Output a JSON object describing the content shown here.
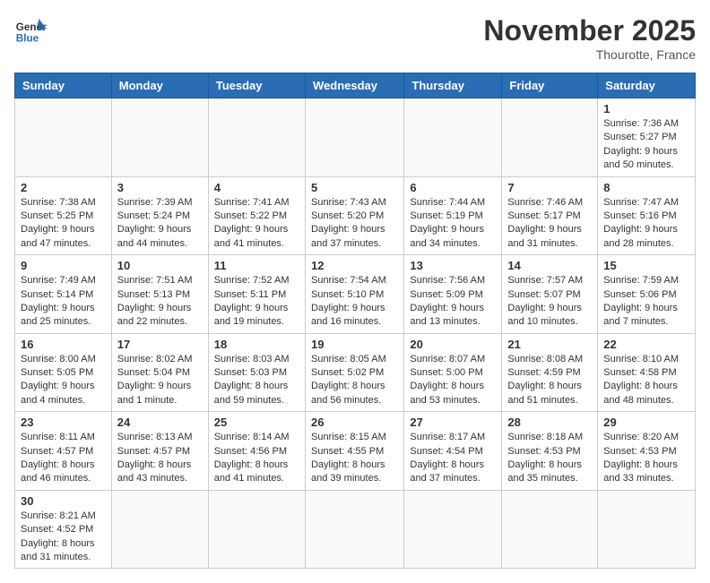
{
  "header": {
    "logo_text_general": "General",
    "logo_text_blue": "Blue",
    "month_title": "November 2025",
    "location": "Thourotte, France"
  },
  "weekdays": [
    "Sunday",
    "Monday",
    "Tuesday",
    "Wednesday",
    "Thursday",
    "Friday",
    "Saturday"
  ],
  "weeks": [
    [
      {
        "day": "",
        "info": ""
      },
      {
        "day": "",
        "info": ""
      },
      {
        "day": "",
        "info": ""
      },
      {
        "day": "",
        "info": ""
      },
      {
        "day": "",
        "info": ""
      },
      {
        "day": "",
        "info": ""
      },
      {
        "day": "1",
        "info": "Sunrise: 7:36 AM\nSunset: 5:27 PM\nDaylight: 9 hours\nand 50 minutes."
      }
    ],
    [
      {
        "day": "2",
        "info": "Sunrise: 7:38 AM\nSunset: 5:25 PM\nDaylight: 9 hours\nand 47 minutes."
      },
      {
        "day": "3",
        "info": "Sunrise: 7:39 AM\nSunset: 5:24 PM\nDaylight: 9 hours\nand 44 minutes."
      },
      {
        "day": "4",
        "info": "Sunrise: 7:41 AM\nSunset: 5:22 PM\nDaylight: 9 hours\nand 41 minutes."
      },
      {
        "day": "5",
        "info": "Sunrise: 7:43 AM\nSunset: 5:20 PM\nDaylight: 9 hours\nand 37 minutes."
      },
      {
        "day": "6",
        "info": "Sunrise: 7:44 AM\nSunset: 5:19 PM\nDaylight: 9 hours\nand 34 minutes."
      },
      {
        "day": "7",
        "info": "Sunrise: 7:46 AM\nSunset: 5:17 PM\nDaylight: 9 hours\nand 31 minutes."
      },
      {
        "day": "8",
        "info": "Sunrise: 7:47 AM\nSunset: 5:16 PM\nDaylight: 9 hours\nand 28 minutes."
      }
    ],
    [
      {
        "day": "9",
        "info": "Sunrise: 7:49 AM\nSunset: 5:14 PM\nDaylight: 9 hours\nand 25 minutes."
      },
      {
        "day": "10",
        "info": "Sunrise: 7:51 AM\nSunset: 5:13 PM\nDaylight: 9 hours\nand 22 minutes."
      },
      {
        "day": "11",
        "info": "Sunrise: 7:52 AM\nSunset: 5:11 PM\nDaylight: 9 hours\nand 19 minutes."
      },
      {
        "day": "12",
        "info": "Sunrise: 7:54 AM\nSunset: 5:10 PM\nDaylight: 9 hours\nand 16 minutes."
      },
      {
        "day": "13",
        "info": "Sunrise: 7:56 AM\nSunset: 5:09 PM\nDaylight: 9 hours\nand 13 minutes."
      },
      {
        "day": "14",
        "info": "Sunrise: 7:57 AM\nSunset: 5:07 PM\nDaylight: 9 hours\nand 10 minutes."
      },
      {
        "day": "15",
        "info": "Sunrise: 7:59 AM\nSunset: 5:06 PM\nDaylight: 9 hours\nand 7 minutes."
      }
    ],
    [
      {
        "day": "16",
        "info": "Sunrise: 8:00 AM\nSunset: 5:05 PM\nDaylight: 9 hours\nand 4 minutes."
      },
      {
        "day": "17",
        "info": "Sunrise: 8:02 AM\nSunset: 5:04 PM\nDaylight: 9 hours\nand 1 minute."
      },
      {
        "day": "18",
        "info": "Sunrise: 8:03 AM\nSunset: 5:03 PM\nDaylight: 8 hours\nand 59 minutes."
      },
      {
        "day": "19",
        "info": "Sunrise: 8:05 AM\nSunset: 5:02 PM\nDaylight: 8 hours\nand 56 minutes."
      },
      {
        "day": "20",
        "info": "Sunrise: 8:07 AM\nSunset: 5:00 PM\nDaylight: 8 hours\nand 53 minutes."
      },
      {
        "day": "21",
        "info": "Sunrise: 8:08 AM\nSunset: 4:59 PM\nDaylight: 8 hours\nand 51 minutes."
      },
      {
        "day": "22",
        "info": "Sunrise: 8:10 AM\nSunset: 4:58 PM\nDaylight: 8 hours\nand 48 minutes."
      }
    ],
    [
      {
        "day": "23",
        "info": "Sunrise: 8:11 AM\nSunset: 4:57 PM\nDaylight: 8 hours\nand 46 minutes."
      },
      {
        "day": "24",
        "info": "Sunrise: 8:13 AM\nSunset: 4:57 PM\nDaylight: 8 hours\nand 43 minutes."
      },
      {
        "day": "25",
        "info": "Sunrise: 8:14 AM\nSunset: 4:56 PM\nDaylight: 8 hours\nand 41 minutes."
      },
      {
        "day": "26",
        "info": "Sunrise: 8:15 AM\nSunset: 4:55 PM\nDaylight: 8 hours\nand 39 minutes."
      },
      {
        "day": "27",
        "info": "Sunrise: 8:17 AM\nSunset: 4:54 PM\nDaylight: 8 hours\nand 37 minutes."
      },
      {
        "day": "28",
        "info": "Sunrise: 8:18 AM\nSunset: 4:53 PM\nDaylight: 8 hours\nand 35 minutes."
      },
      {
        "day": "29",
        "info": "Sunrise: 8:20 AM\nSunset: 4:53 PM\nDaylight: 8 hours\nand 33 minutes."
      }
    ],
    [
      {
        "day": "30",
        "info": "Sunrise: 8:21 AM\nSunset: 4:52 PM\nDaylight: 8 hours\nand 31 minutes."
      },
      {
        "day": "",
        "info": ""
      },
      {
        "day": "",
        "info": ""
      },
      {
        "day": "",
        "info": ""
      },
      {
        "day": "",
        "info": ""
      },
      {
        "day": "",
        "info": ""
      },
      {
        "day": "",
        "info": ""
      }
    ]
  ]
}
